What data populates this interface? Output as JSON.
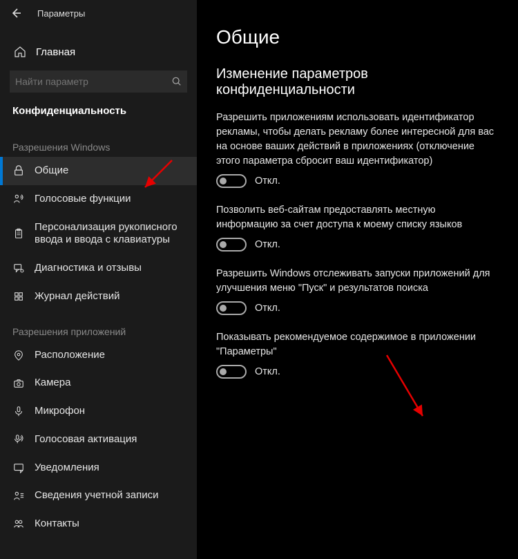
{
  "header": {
    "title": "Параметры"
  },
  "home": {
    "label": "Главная"
  },
  "search": {
    "placeholder": "Найти параметр"
  },
  "category": {
    "title": "Конфиденциальность"
  },
  "sections": {
    "windows_permissions": "Разрешения Windows",
    "app_permissions": "Разрешения приложений"
  },
  "sidebar": {
    "windows": [
      {
        "label": "Общие"
      },
      {
        "label": "Голосовые функции"
      },
      {
        "label": "Персонализация рукописного ввода и ввода с клавиатуры"
      },
      {
        "label": "Диагностика и отзывы"
      },
      {
        "label": "Журнал действий"
      }
    ],
    "apps": [
      {
        "label": "Расположение"
      },
      {
        "label": "Камера"
      },
      {
        "label": "Микрофон"
      },
      {
        "label": "Голосовая активация"
      },
      {
        "label": "Уведомления"
      },
      {
        "label": "Сведения учетной записи"
      },
      {
        "label": "Контакты"
      }
    ]
  },
  "page": {
    "heading": "Общие",
    "subheading": "Изменение параметров конфиденциальности"
  },
  "settings": [
    {
      "desc": "Разрешить приложениям использовать идентификатор рекламы, чтобы делать рекламу более интересной для вас на основе ваших действий в приложениях (отключение этого параметра сбросит ваш идентификатор)",
      "state": "Откл."
    },
    {
      "desc": "Позволить веб-сайтам предоставлять местную информацию за счет доступа к моему списку языков",
      "state": "Откл."
    },
    {
      "desc": "Разрешить Windows отслеживать запуски приложений для улучшения меню \"Пуск\" и результатов поиска",
      "state": "Откл."
    },
    {
      "desc": "Показывать рекомендуемое содержимое в приложении \"Параметры\"",
      "state": "Откл."
    }
  ]
}
